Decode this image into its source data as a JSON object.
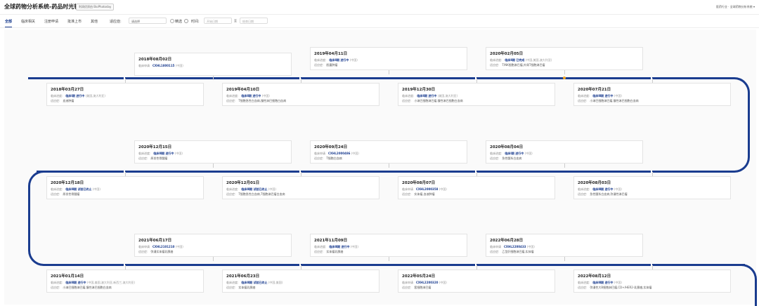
{
  "app": {
    "title": "全球药物分析系统-药品时光轴",
    "badge": "利润优质由 BioPhatoday",
    "user": "医药行业 · 全球药物分析系统 ▾"
  },
  "tabs": [
    {
      "label": "全部"
    },
    {
      "label": "临床相关"
    },
    {
      "label": "注册申请"
    },
    {
      "label": "批准上市"
    },
    {
      "label": "其他"
    }
  ],
  "filters": {
    "indication_label": "适应症:",
    "indication_value": "请选择",
    "check_label": "精选",
    "time_label": "时间:",
    "start_placeholder": "开始日期",
    "separator": "至",
    "end_placeholder": "结束日期"
  },
  "labels": {
    "trial": "临床进度:",
    "apply": "临床申请",
    "ind": "适应症:"
  },
  "cards": [
    {
      "date": "2018年08月02日",
      "kind": "apply",
      "code": "CXHL1800115",
      "note": "(中国)",
      "ind": ""
    },
    {
      "date": "2019年04月11日",
      "kind": "trial",
      "stage": "临床Ⅱ期 进行中",
      "note": "(中国)",
      "ind": "胆囊肿瘤"
    },
    {
      "date": "2020年02月05日",
      "kind": "trial",
      "stage": "临床Ⅱ期 已完成",
      "note": "(中国,美国,澳大利亚)",
      "ind": "T/NK细胞淋巴瘤,外周T细胞淋巴瘤"
    },
    {
      "date": "2018年03月27日",
      "kind": "trial",
      "stage": "临床Ⅰ期 进行中",
      "note": "(美国,澳大利亚)",
      "ind": "血液肿瘤"
    },
    {
      "date": "2019年04月10日",
      "kind": "trial",
      "stage": "临床Ⅱ期 进行中",
      "note": "(中国)",
      "ind": "T细胞急性白血病,慢性淋巴细胞白血病"
    },
    {
      "date": "2019年12月30日",
      "kind": "trial",
      "stage": "临床Ⅱ期 进行中",
      "note": "(美国,澳大利亚)",
      "ind": "小淋巴细胞淋巴瘤,慢性淋巴细胞白血病"
    },
    {
      "date": "2020年07月21日",
      "kind": "trial",
      "stage": "临床Ⅲ期 进行中",
      "note": "(中国)",
      "ind": "小淋巴细胞淋巴瘤,慢性淋巴细胞白血病"
    },
    {
      "date": "2020年12月15日",
      "kind": "trial",
      "stage": "临床Ⅲ期 进行中",
      "note": "(中国)",
      "ind": "原发性骨髓瘤"
    },
    {
      "date": "2020年09月24日",
      "kind": "apply",
      "code": "CXHL2000486",
      "note": "(中国)",
      "ind": "T细胞白血病"
    },
    {
      "date": "2020年08月04日",
      "kind": "trial",
      "stage": "临床Ⅰ期 进行中",
      "note": "(中国)",
      "ind": "急性髓系白血病"
    },
    {
      "date": "2020年12月18日",
      "kind": "trial",
      "stage": "临床Ⅲ期 试验已终止",
      "note": "(中国)",
      "ind": "原发性骨髓瘤"
    },
    {
      "date": "2020年12月01日",
      "kind": "trial",
      "stage": "临床Ⅲ期 试验已终止",
      "note": "(中国)",
      "ind": "T细胞急性白血病,T细胞淋巴瘤白血病"
    },
    {
      "date": "2020年08月07日",
      "kind": "apply",
      "code": "CXHL2000358",
      "note": "(中国)",
      "ind": "实体瘤,血液肿瘤"
    },
    {
      "date": "2020年08月03日",
      "kind": "trial",
      "stage": "临床Ⅲ期 进行中",
      "note": "(中国)",
      "ind": "急性髓系白血病,弥漫性淋巴瘤"
    },
    {
      "date": "2021年06月17日",
      "kind": "apply",
      "code": "CXHL2101210",
      "note": "(中国)",
      "ind": "弥漫实体瘤乳腺癌"
    },
    {
      "date": "2021年11月09日",
      "kind": "trial",
      "stage": "临床Ⅲ期 进行中",
      "note": "(中国)",
      "ind": "实体瘤乳腺癌"
    },
    {
      "date": "2022年06月28日",
      "kind": "apply",
      "code": "CXHL2200433",
      "note": "(中国)",
      "ind": "乙型肝细胞淋巴瘤,实体瘤"
    },
    {
      "date": "2021年01月14日",
      "kind": "trial",
      "stage": "临床Ⅲ期 进行中",
      "note": "(中国,美国,澳大利亚,新西兰,澳大利亚)",
      "ind": "小淋巴细胞淋巴瘤,慢性淋巴细胞白血病"
    },
    {
      "date": "2021年06月23日",
      "kind": "trial",
      "stage": "临床Ⅲ期 试验已终止",
      "note": "(中国,美国)",
      "ind": "实体瘤乳腺癌"
    },
    {
      "date": "2022年05月24日",
      "kind": "apply",
      "code": "CXHL2200320",
      "note": "(中国)",
      "ind": "套细胞淋巴瘤"
    },
    {
      "date": "2022年08月12日",
      "kind": "trial",
      "stage": "临床Ⅲ期 进行中",
      "note": "(中国)",
      "ind": "弥漫性大B细胞淋巴瘤,CD+/HER2-乳腺癌,实体瘤"
    }
  ],
  "colors": {
    "accent": "#1a3c8f",
    "marker": "#f2a623"
  }
}
